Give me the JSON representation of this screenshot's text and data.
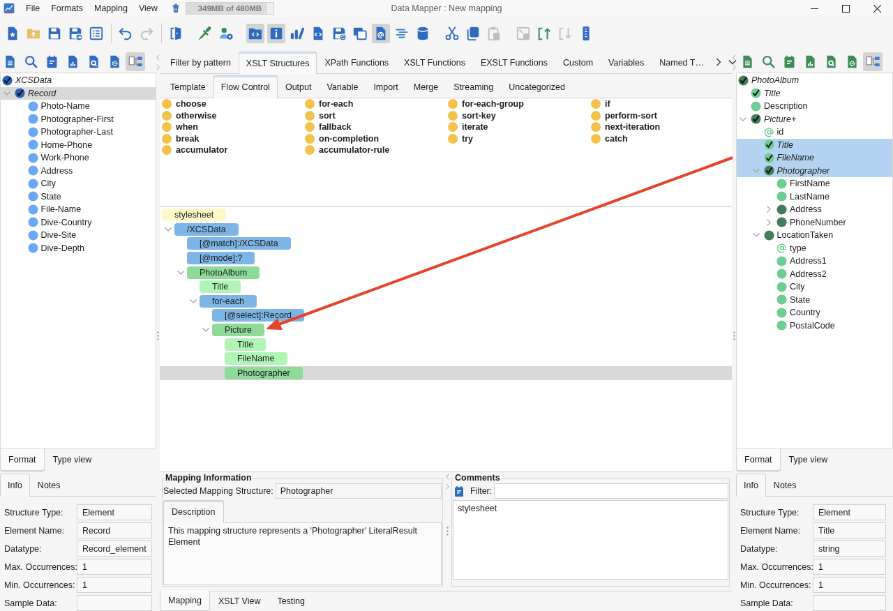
{
  "window": {
    "title": "Data Mapper : New mapping"
  },
  "menu": [
    "File",
    "Formats",
    "Mapping",
    "View"
  ],
  "memory": {
    "label": "349MB of 480MB",
    "level": 0.93
  },
  "toolbar": {
    "groups": [
      [
        {
          "kind": "new",
          "on": false,
          "disabled": false
        },
        {
          "kind": "open",
          "on": false,
          "disabled": false
        },
        {
          "kind": "save",
          "on": false,
          "disabled": false
        },
        {
          "kind": "save-as",
          "on": false,
          "disabled": false
        },
        {
          "kind": "list",
          "on": false,
          "disabled": false
        }
      ],
      [
        {
          "kind": "undo",
          "on": false,
          "disabled": false
        },
        {
          "kind": "redo",
          "on": false,
          "disabled": true
        }
      ],
      [
        {
          "kind": "exit",
          "on": false,
          "disabled": false
        }
      ],
      [
        {
          "kind": "dropper",
          "on": false,
          "disabled": false
        },
        {
          "kind": "people-gear",
          "on": false,
          "disabled": false
        }
      ],
      [
        {
          "kind": "folder-code",
          "on": true,
          "disabled": false
        },
        {
          "kind": "info",
          "on": true,
          "disabled": false
        },
        {
          "kind": "chart",
          "on": false,
          "disabled": false
        },
        {
          "kind": "doc-code",
          "on": false,
          "disabled": false
        },
        {
          "kind": "save-sync",
          "on": false,
          "disabled": false
        },
        {
          "kind": "windows",
          "on": false,
          "disabled": false
        },
        {
          "kind": "doc-at",
          "on": true,
          "disabled": false
        },
        {
          "kind": "lines",
          "on": false,
          "disabled": false
        },
        {
          "kind": "database",
          "on": false,
          "disabled": false
        }
      ],
      [
        {
          "kind": "cut",
          "on": false,
          "disabled": false
        },
        {
          "kind": "copy",
          "on": false,
          "disabled": false
        },
        {
          "kind": "paste",
          "on": false,
          "disabled": true
        }
      ],
      [
        {
          "kind": "resize",
          "on": false,
          "disabled": true
        },
        {
          "kind": "export",
          "on": false,
          "disabled": false
        },
        {
          "kind": "import",
          "on": false,
          "disabled": true
        },
        {
          "kind": "ruler",
          "on": false,
          "disabled": false
        }
      ]
    ]
  },
  "source_panel": {
    "kind": "source",
    "focused": false,
    "toolbar": [
      {
        "kind": "document",
        "on": false
      },
      {
        "kind": "search",
        "on": false
      },
      {
        "kind": "note",
        "on": false
      },
      {
        "kind": "chart",
        "on": false
      },
      {
        "kind": "find",
        "on": false
      },
      {
        "kind": "settings",
        "on": false
      },
      {
        "kind": "tree",
        "on": true
      }
    ],
    "tree": {
      "label": "XCSData",
      "kind": "complex",
      "mapped": true,
      "selected": false,
      "children": [
        {
          "label": "Record",
          "kind": "complex",
          "mapped": true,
          "selected": true,
          "expanded": true,
          "children": [
            {
              "label": "Photo-Name",
              "kind": "simple",
              "mapped": false,
              "selected": false
            },
            {
              "label": "Photographer-First",
              "kind": "simple",
              "mapped": false,
              "selected": false
            },
            {
              "label": "Photographer-Last",
              "kind": "simple",
              "mapped": false,
              "selected": false
            },
            {
              "label": "Home-Phone",
              "kind": "simple",
              "mapped": false,
              "selected": false
            },
            {
              "label": "Work-Phone",
              "kind": "simple",
              "mapped": false,
              "selected": false
            },
            {
              "label": "Address",
              "kind": "simple",
              "mapped": false,
              "selected": false
            },
            {
              "label": "City",
              "kind": "simple",
              "mapped": false,
              "selected": false
            },
            {
              "label": "State",
              "kind": "simple",
              "mapped": false,
              "selected": false
            },
            {
              "label": "File-Name",
              "kind": "simple",
              "mapped": false,
              "selected": false
            },
            {
              "label": "Dive-Country",
              "kind": "simple",
              "mapped": false,
              "selected": false
            },
            {
              "label": "Dive-Site",
              "kind": "simple",
              "mapped": false,
              "selected": false
            },
            {
              "label": "Dive-Depth",
              "kind": "simple",
              "mapped": false,
              "selected": false
            }
          ]
        }
      ]
    },
    "view_tabs": [
      {
        "label": "Format",
        "selected": true
      },
      {
        "label": "Type view",
        "selected": false
      }
    ],
    "info_tabs": [
      {
        "label": "Info",
        "selected": true
      },
      {
        "label": "Notes",
        "selected": false
      }
    ],
    "fields": [
      {
        "label": "Structure Type:",
        "value": "Element"
      },
      {
        "label": "Element Name:",
        "value": "Record"
      },
      {
        "label": "Datatype:",
        "value": "Record_element"
      },
      {
        "label": "Max. Occurrences:",
        "value": "1"
      },
      {
        "label": "Min. Occurrences:",
        "value": "1"
      },
      {
        "label": "Sample Data:"
      }
    ]
  },
  "library": {
    "tabs": [
      {
        "label": "Filter by pattern",
        "selected": false
      },
      {
        "label": "XSLT Structures",
        "selected": true
      },
      {
        "label": "XPath Functions",
        "selected": false
      },
      {
        "label": "XSLT Functions",
        "selected": false
      },
      {
        "label": "EXSLT Functions",
        "selected": false
      },
      {
        "label": "Custom",
        "selected": false
      },
      {
        "label": "Variables",
        "selected": false
      },
      {
        "label": "Named T…",
        "selected": false
      }
    ],
    "subtabs": [
      {
        "label": "Template",
        "selected": false
      },
      {
        "label": "Flow Control",
        "selected": true
      },
      {
        "label": "Output",
        "selected": false
      },
      {
        "label": "Variable",
        "selected": false
      },
      {
        "label": "Import",
        "selected": false
      },
      {
        "label": "Merge",
        "selected": false
      },
      {
        "label": "Streaming",
        "selected": false
      },
      {
        "label": "Uncategorized",
        "selected": false
      }
    ],
    "palette": [
      [
        "choose",
        "otherwise",
        "when",
        "break",
        "accumulator"
      ],
      [
        "for-each",
        "sort",
        "fallback",
        "on-completion",
        "accumulator-rule"
      ],
      [
        "for-each-group",
        "sort-key",
        "iterate",
        "try"
      ],
      [
        "if",
        "perform-sort",
        "next-iteration",
        "catch"
      ]
    ]
  },
  "mapping": {
    "focused": false,
    "tree": {
      "label": "stylesheet",
      "kind": "root",
      "selected": false,
      "children": [
        {
          "label": "/XCSData",
          "kind": "template",
          "selected": false,
          "expanded": true,
          "children": [
            {
              "label": "[@match]:/XCSData",
              "kind": "attribute",
              "selected": false
            },
            {
              "label": "[@mode]:?",
              "kind": "attribute",
              "selected": false
            },
            {
              "label": "PhotoAlbum",
              "kind": "element",
              "selected": false,
              "expanded": true,
              "children": [
                {
                  "label": "Title",
                  "kind": "text",
                  "selected": false
                },
                {
                  "label": "for-each",
                  "kind": "instruction",
                  "selected": false,
                  "expanded": true,
                  "children": [
                    {
                      "label": "[@select]:Record",
                      "kind": "attribute",
                      "selected": false
                    },
                    {
                      "label": "Picture",
                      "kind": "element",
                      "selected": false,
                      "expanded": true,
                      "children": [
                        {
                          "label": "Title",
                          "kind": "text",
                          "selected": false
                        },
                        {
                          "label": "FileName",
                          "kind": "text",
                          "selected": false
                        },
                        {
                          "label": "Photographer",
                          "kind": "element",
                          "selected": true
                        }
                      ]
                    }
                  ]
                }
              ]
            }
          ]
        }
      ]
    }
  },
  "mapping_information": {
    "title": "Mapping Information",
    "structure_label": "Selected Mapping Structure:",
    "structure_value": "Photographer",
    "tabs": [
      {
        "label": "Description",
        "selected": true
      }
    ],
    "description": "This mapping structure represents a 'Photographer' LiteralResult Element"
  },
  "comments": {
    "title": "Comments",
    "filter_label": "Filter:",
    "items": [
      "stylesheet"
    ]
  },
  "bottom_tabs": [
    {
      "label": "Mapping",
      "selected": true
    },
    {
      "label": "XSLT View",
      "selected": false
    },
    {
      "label": "Testing",
      "selected": false
    }
  ],
  "target_panel": {
    "kind": "target",
    "focused": true,
    "toolbar": [
      {
        "kind": "document",
        "on": false
      },
      {
        "kind": "search",
        "on": false
      },
      {
        "kind": "note",
        "on": false
      },
      {
        "kind": "chart",
        "on": false
      },
      {
        "kind": "find",
        "on": false
      },
      {
        "kind": "settings",
        "on": false
      },
      {
        "kind": "tree",
        "on": true
      }
    ],
    "tree": {
      "label": "PhotoAlbum",
      "kind": "complex",
      "mapped": true,
      "selected": false,
      "children": [
        {
          "label": "Title",
          "kind": "simple",
          "mapped": true,
          "selected": false
        },
        {
          "label": "Description",
          "kind": "simple",
          "mapped": false,
          "selected": false
        },
        {
          "label": "Picture+",
          "kind": "complex",
          "mapped": true,
          "selected": false,
          "expanded": true,
          "children": [
            {
              "label": "id",
              "kind": "attribute",
              "selected": false
            },
            {
              "label": "Title",
              "kind": "simple",
              "mapped": true,
              "selected": true
            },
            {
              "label": "FileName",
              "kind": "simple",
              "mapped": true,
              "selected": true
            },
            {
              "label": "Photographer",
              "kind": "complex",
              "mapped": true,
              "selected": true,
              "expanded": true,
              "children": [
                {
                  "label": "FirstName",
                  "kind": "simple",
                  "mapped": false,
                  "selected": false
                },
                {
                  "label": "LastName",
                  "kind": "simple",
                  "mapped": false,
                  "selected": false
                },
                {
                  "label": "Address",
                  "kind": "complex",
                  "mapped": false,
                  "selected": false,
                  "expanded": false
                },
                {
                  "label": "PhoneNumber",
                  "kind": "complex",
                  "mapped": false,
                  "selected": false,
                  "expanded": false
                }
              ]
            },
            {
              "label": "LocationTaken",
              "kind": "complex",
              "mapped": false,
              "selected": false,
              "expanded": true,
              "children": [
                {
                  "label": "type",
                  "kind": "attribute",
                  "selected": false
                },
                {
                  "label": "Address1",
                  "kind": "simple",
                  "mapped": false,
                  "selected": false
                },
                {
                  "label": "Address2",
                  "kind": "simple",
                  "mapped": false,
                  "selected": false
                },
                {
                  "label": "City",
                  "kind": "simple",
                  "mapped": false,
                  "selected": false
                },
                {
                  "label": "State",
                  "kind": "simple",
                  "mapped": false,
                  "selected": false
                },
                {
                  "label": "Country",
                  "kind": "simple",
                  "mapped": false,
                  "selected": false
                },
                {
                  "label": "PostalCode",
                  "kind": "simple",
                  "mapped": false,
                  "selected": false
                }
              ]
            }
          ]
        }
      ]
    },
    "view_tabs": [
      {
        "label": "Format",
        "selected": true
      },
      {
        "label": "Type view",
        "selected": false
      }
    ],
    "info_tabs": [
      {
        "label": "Info",
        "selected": true
      },
      {
        "label": "Notes",
        "selected": false
      }
    ],
    "fields": [
      {
        "label": "Structure Type:",
        "value": "Element"
      },
      {
        "label": "Element Name:",
        "value": "Title"
      },
      {
        "label": "Datatype:",
        "value": "string"
      },
      {
        "label": "Max. Occurrences:",
        "value": "1"
      },
      {
        "label": "Min. Occurrences:",
        "value": "1"
      },
      {
        "label": "Sample Data:"
      }
    ]
  }
}
